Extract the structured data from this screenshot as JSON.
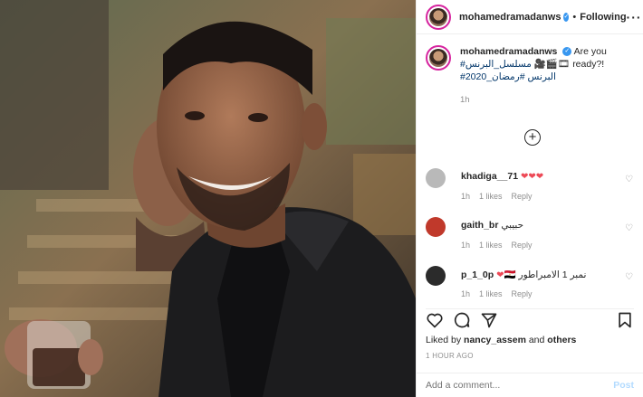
{
  "post": {
    "username": "mohamedramadanws",
    "dot": "•",
    "follow_status": "Following",
    "more_glyph": "···"
  },
  "caption": {
    "username": "mohamedramadanws",
    "text_1": "Are you",
    "text_2": "ready?!",
    "hashtag_1": "#مسلسل_البرنس",
    "hashtag_2": "#رمضان_2020",
    "hashtag_3": "#البرنس",
    "time": "1h"
  },
  "load_more": "+",
  "comments": [
    {
      "username": "khadiga__71",
      "text": "❤❤❤",
      "time": "1h",
      "likes": "1 likes",
      "reply": "Reply"
    },
    {
      "username": "gaith_br",
      "text": "حبيبي",
      "time": "1h",
      "likes": "1 likes",
      "reply": "Reply"
    },
    {
      "username": "p_1_0p",
      "text": "نمبر 1 الامبراطور",
      "time": "1h",
      "likes": "1 likes",
      "reply": "Reply"
    }
  ],
  "likes": {
    "prefix": "Liked by",
    "user": "nancy_assem",
    "and": "and",
    "others": "others"
  },
  "timestamp": "1 HOUR AGO",
  "add_comment": {
    "placeholder": "Add a comment...",
    "post_label": "Post"
  },
  "icons": {
    "heart": "heart-icon",
    "comment": "comment-icon",
    "share": "share-icon",
    "save": "bookmark-icon"
  }
}
